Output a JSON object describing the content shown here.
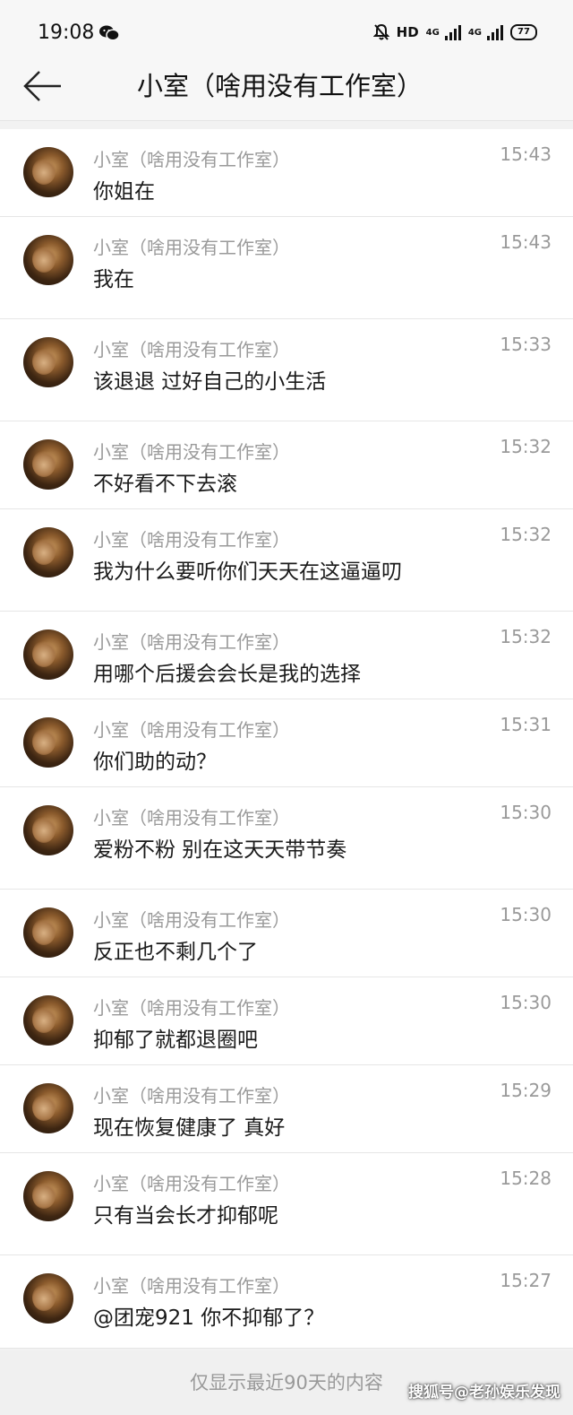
{
  "status_bar": {
    "time": "19:08",
    "hd": "HD",
    "net1": "4G",
    "net2": "4G",
    "battery": "77"
  },
  "header": {
    "title": "小室（啥用没有工作室）"
  },
  "messages": [
    {
      "sender": "小室（啥用没有工作室）",
      "time": "15:43",
      "text": "你姐在"
    },
    {
      "sender": "小室（啥用没有工作室）",
      "time": "15:43",
      "text": "我在"
    },
    {
      "sender": "小室（啥用没有工作室）",
      "time": "15:33",
      "text": "该退退 过好自己的小生活"
    },
    {
      "sender": "小室（啥用没有工作室）",
      "time": "15:32",
      "text": "不好看不下去滚"
    },
    {
      "sender": "小室（啥用没有工作室）",
      "time": "15:32",
      "text": "我为什么要听你们天天在这逼逼叨"
    },
    {
      "sender": "小室（啥用没有工作室）",
      "time": "15:32",
      "text": "用哪个后援会会长是我的选择"
    },
    {
      "sender": "小室（啥用没有工作室）",
      "time": "15:31",
      "text": "你们助的动？"
    },
    {
      "sender": "小室（啥用没有工作室）",
      "time": "15:30",
      "text": "爱粉不粉 别在这天天带节奏"
    },
    {
      "sender": "小室（啥用没有工作室）",
      "time": "15:30",
      "text": "反正也不剩几个了"
    },
    {
      "sender": "小室（啥用没有工作室）",
      "time": "15:30",
      "text": "抑郁了就都退圈吧"
    },
    {
      "sender": "小室（啥用没有工作室）",
      "time": "15:29",
      "text": "现在恢复健康了 真好"
    },
    {
      "sender": "小室（啥用没有工作室）",
      "time": "15:28",
      "text": "只有当会长才抑郁呢"
    },
    {
      "sender": "小室（啥用没有工作室）",
      "time": "15:27",
      "text": "@团宠921 你不抑郁了？"
    }
  ],
  "footer": {
    "note": "仅显示最近90天的内容"
  },
  "watermark": "搜狐号@老孙娱乐发现"
}
